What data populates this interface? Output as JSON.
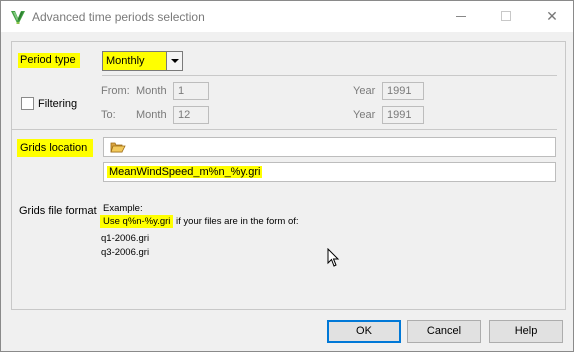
{
  "window": {
    "title": "Advanced time periods selection",
    "minimize_icon": "minimize-icon",
    "maximize_icon": "maximize-icon",
    "close_glyph": "✕"
  },
  "period": {
    "label": "Period type",
    "selected": "Monthly"
  },
  "filtering": {
    "label": "Filtering",
    "checked": false,
    "from_label": "From:",
    "to_label": "To:",
    "month_label": "Month",
    "year_label": "Year",
    "from_month": "1",
    "to_month": "12",
    "from_year": "1991",
    "to_year": "1991"
  },
  "grids": {
    "location_label": "Grids location",
    "location_value": "",
    "pattern_value": "MeanWindSpeed_m%n_%y.gri",
    "format_label": "Grids file format",
    "example_title": "Example:",
    "example_use": "Use q%n-%y.gri",
    "example_rest": " if your files are in the form of:",
    "example_file1": "q1-2006.gri",
    "example_file2": "q3-2006.gri"
  },
  "buttons": {
    "ok": "OK",
    "cancel": "Cancel",
    "help": "Help"
  },
  "colors": {
    "highlight": "#ffff00",
    "focus_border": "#0078d7"
  }
}
